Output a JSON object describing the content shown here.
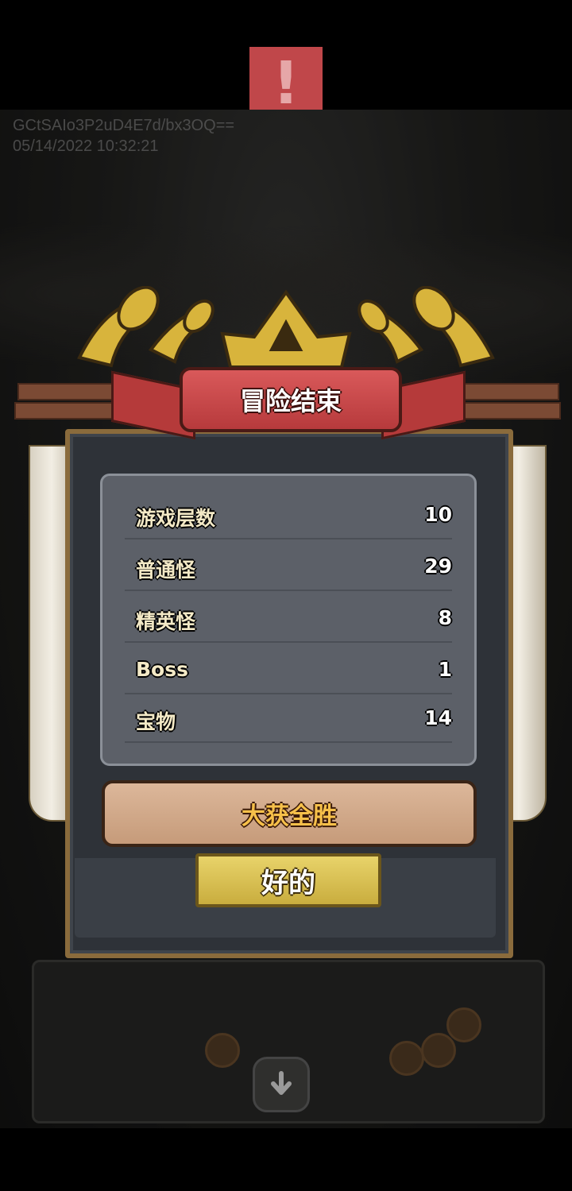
{
  "alert": {
    "glyph": "!"
  },
  "watermark": {
    "line1": "GCtSAIo3P2uD4E7d/bx3OQ==",
    "line2": "05/14/2022 10:32:21"
  },
  "dialog": {
    "title": "冒险结束",
    "stats": [
      {
        "label": "游戏层数",
        "value": "10"
      },
      {
        "label": "普通怪",
        "value": "29"
      },
      {
        "label": "精英怪",
        "value": "8"
      },
      {
        "label": "Boss",
        "value": "1"
      },
      {
        "label": "宝物",
        "value": "14"
      }
    ],
    "result": "大获全胜",
    "confirm_label": "好的"
  },
  "colors": {
    "banner": "#c94546",
    "gold_button": "#d9c052",
    "verdict_text": "#f6c04a"
  }
}
